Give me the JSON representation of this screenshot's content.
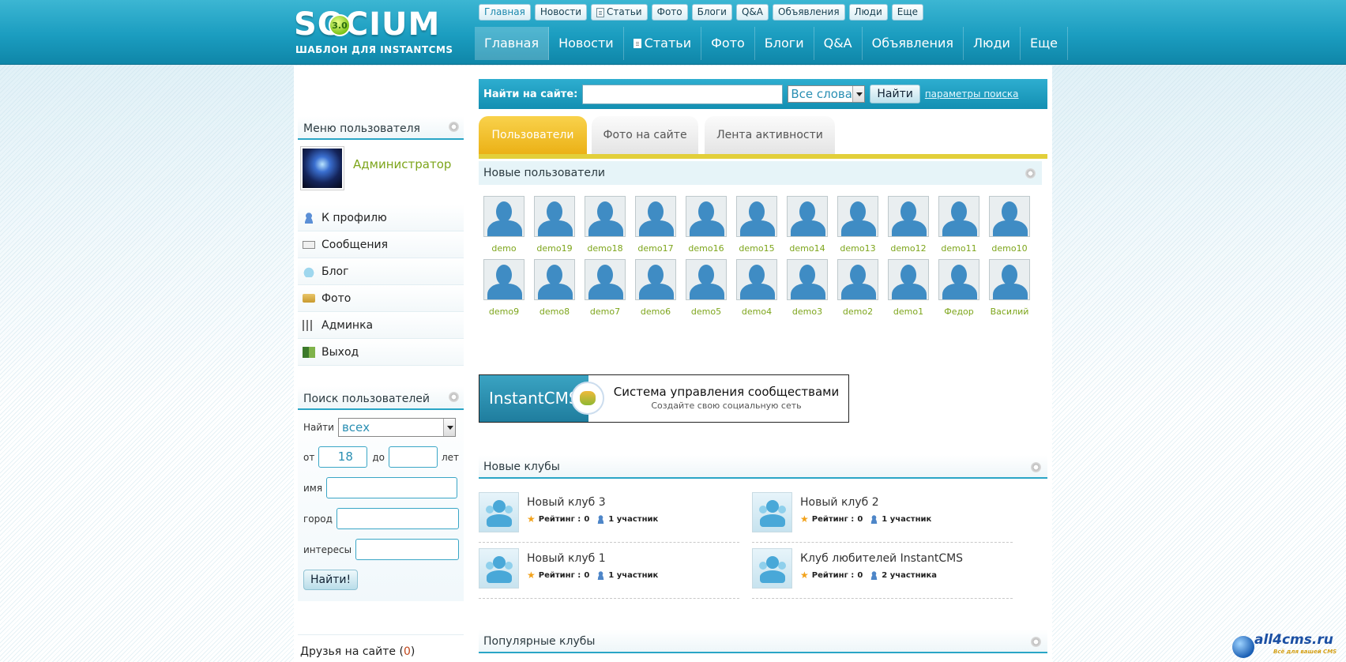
{
  "logo": {
    "text": "SOCIUM",
    "badge": "3.0",
    "subtitle": "ШАБЛОН ДЛЯ INSTANTCMS"
  },
  "topnav_small": [
    {
      "label": "Главная",
      "active": true
    },
    {
      "label": "Новости"
    },
    {
      "label": "Статьи",
      "icon": "document-icon"
    },
    {
      "label": "Фото"
    },
    {
      "label": "Блоги"
    },
    {
      "label": "Q&A"
    },
    {
      "label": "Объявления"
    },
    {
      "label": "Люди"
    },
    {
      "label": "Еще"
    }
  ],
  "mainnav": [
    {
      "label": "Главная",
      "active": true
    },
    {
      "label": "Новости"
    },
    {
      "label": "Статьи",
      "icon": "document-icon"
    },
    {
      "label": "Фото"
    },
    {
      "label": "Блоги"
    },
    {
      "label": "Q&A"
    },
    {
      "label": "Объявления"
    },
    {
      "label": "Люди"
    },
    {
      "label": "Еще"
    }
  ],
  "user_menu": {
    "title": "Меню пользователя",
    "user_name": "Администратор",
    "items": [
      {
        "label": "К профилю",
        "icon": "user-icon"
      },
      {
        "label": "Сообщения",
        "icon": "mail-icon"
      },
      {
        "label": "Блог",
        "icon": "cloud-icon"
      },
      {
        "label": "Фото",
        "icon": "folder-icon"
      },
      {
        "label": "Админка",
        "icon": "bars-icon"
      },
      {
        "label": "Выход",
        "icon": "exit-icon"
      }
    ]
  },
  "user_search": {
    "title": "Поиск пользователей",
    "find_label": "Найти",
    "find_value": "всех",
    "from_label": "от",
    "from_value": "18",
    "to_label": "до",
    "to_value": "",
    "years_label": "лет",
    "name_label": "имя",
    "city_label": "город",
    "interests_label": "интересы",
    "submit": "Найти!"
  },
  "friends": {
    "label": "Друзья на сайте",
    "count": "0"
  },
  "site_search": {
    "label": "Найти на сайте:",
    "query": "",
    "mode": "Все слова",
    "button": "Найти",
    "advanced": "параметры поиска"
  },
  "tabs": [
    {
      "label": "Пользователи",
      "active": true
    },
    {
      "label": "Фото на сайте"
    },
    {
      "label": "Лента активности"
    }
  ],
  "new_users": {
    "title": "Новые пользователи",
    "users": [
      "demo",
      "demo19",
      "demo18",
      "demo17",
      "demo16",
      "demo15",
      "demo14",
      "demo13",
      "demo12",
      "demo11",
      "demo10",
      "demo9",
      "demo8",
      "demo7",
      "demo6",
      "demo5",
      "demo4",
      "demo3",
      "demo2",
      "demo1",
      "Федор",
      "Василий"
    ]
  },
  "banner": {
    "brand": "InstantCMS",
    "headline": "Система управления сообществами",
    "tagline": "Создайте свою социальную сеть"
  },
  "new_clubs": {
    "title": "Новые клубы",
    "rating_label": "Рейтинг :",
    "clubs": [
      {
        "name": "Новый клуб 3",
        "rating": "0",
        "members": "1 участник"
      },
      {
        "name": "Новый клуб 2",
        "rating": "0",
        "members": "1 участник"
      },
      {
        "name": "Новый клуб 1",
        "rating": "0",
        "members": "1 участник"
      },
      {
        "name": "Клуб любителей InstantCMS",
        "rating": "0",
        "members": "2 участника"
      }
    ]
  },
  "popular_clubs": {
    "title": "Популярные клубы"
  },
  "watermark": {
    "site": "all4cms.ru",
    "slogan": "Всё для вашей CMS"
  }
}
